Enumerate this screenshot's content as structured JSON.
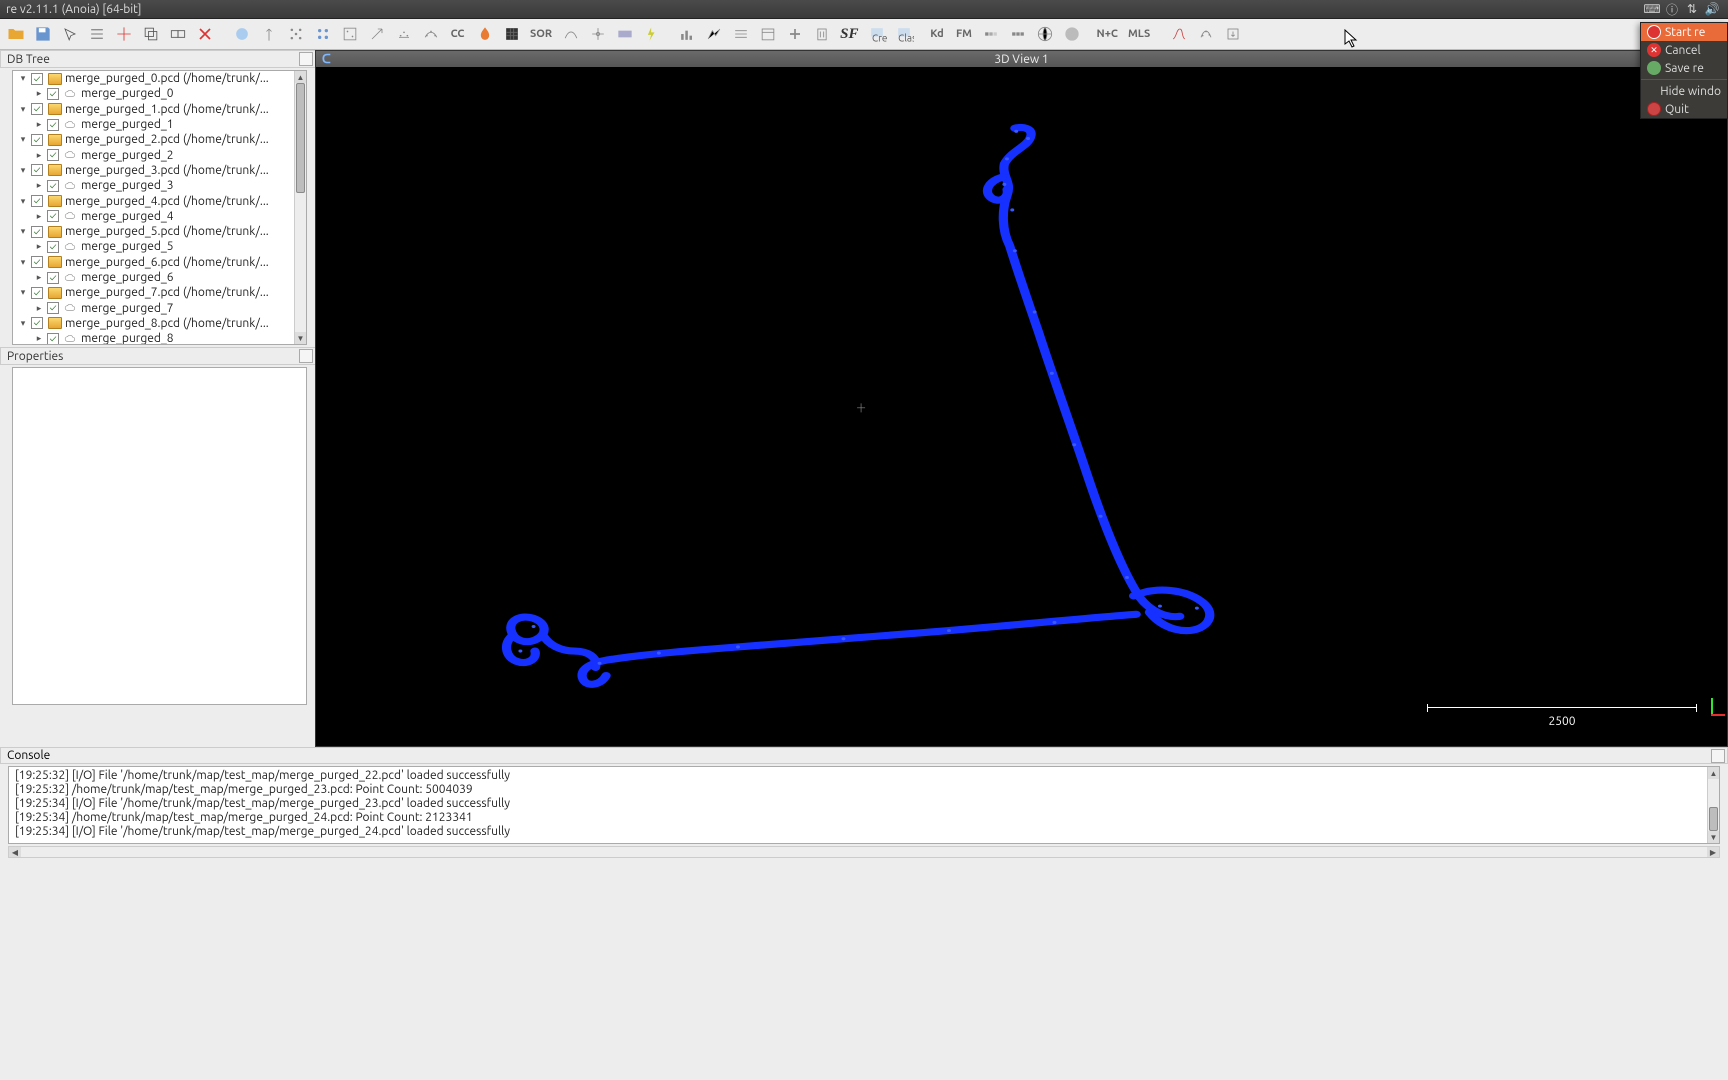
{
  "title": "re v2.11.1 (Anoia) [64-bit]",
  "toolbar_text": {
    "sor": "SOR",
    "sf": "SF",
    "kd": "Kd",
    "fm": "FM",
    "nc": "N+C",
    "mls": "MLS"
  },
  "panels": {
    "dbtree": "DB Tree",
    "properties": "Properties",
    "console": "Console"
  },
  "view": {
    "title": "3D View 1",
    "scale": "2500"
  },
  "tree": [
    {
      "file": "merge_purged_0.pcd (/home/trunk/...",
      "cloud": "merge_purged_0"
    },
    {
      "file": "merge_purged_1.pcd (/home/trunk/...",
      "cloud": "merge_purged_1"
    },
    {
      "file": "merge_purged_2.pcd (/home/trunk/...",
      "cloud": "merge_purged_2"
    },
    {
      "file": "merge_purged_3.pcd (/home/trunk/...",
      "cloud": "merge_purged_3"
    },
    {
      "file": "merge_purged_4.pcd (/home/trunk/...",
      "cloud": "merge_purged_4"
    },
    {
      "file": "merge_purged_5.pcd (/home/trunk/...",
      "cloud": "merge_purged_5"
    },
    {
      "file": "merge_purged_6.pcd (/home/trunk/...",
      "cloud": "merge_purged_6"
    },
    {
      "file": "merge_purged_7.pcd (/home/trunk/...",
      "cloud": "merge_purged_7"
    },
    {
      "file": "merge_purged_8.pcd (/home/trunk/...",
      "cloud": "merge_purged_8"
    }
  ],
  "console_lines": [
    "[19:25:32] [I/O] File '/home/trunk/map/test_map/merge_purged_22.pcd' loaded successfully",
    "[19:25:32] /home/trunk/map/test_map/merge_purged_23.pcd: Point Count: 5004039",
    "[19:25:34] [I/O] File '/home/trunk/map/test_map/merge_purged_23.pcd' loaded successfully",
    "[19:25:34] /home/trunk/map/test_map/merge_purged_24.pcd: Point Count: 2123341",
    "[19:25:34] [I/O] File '/home/trunk/map/test_map/merge_purged_24.pcd' loaded successfully"
  ],
  "ctx": {
    "start": "Start re",
    "cancel": "Cancel",
    "save": "Save re",
    "hide": "Hide windo",
    "quit": "Quit"
  }
}
